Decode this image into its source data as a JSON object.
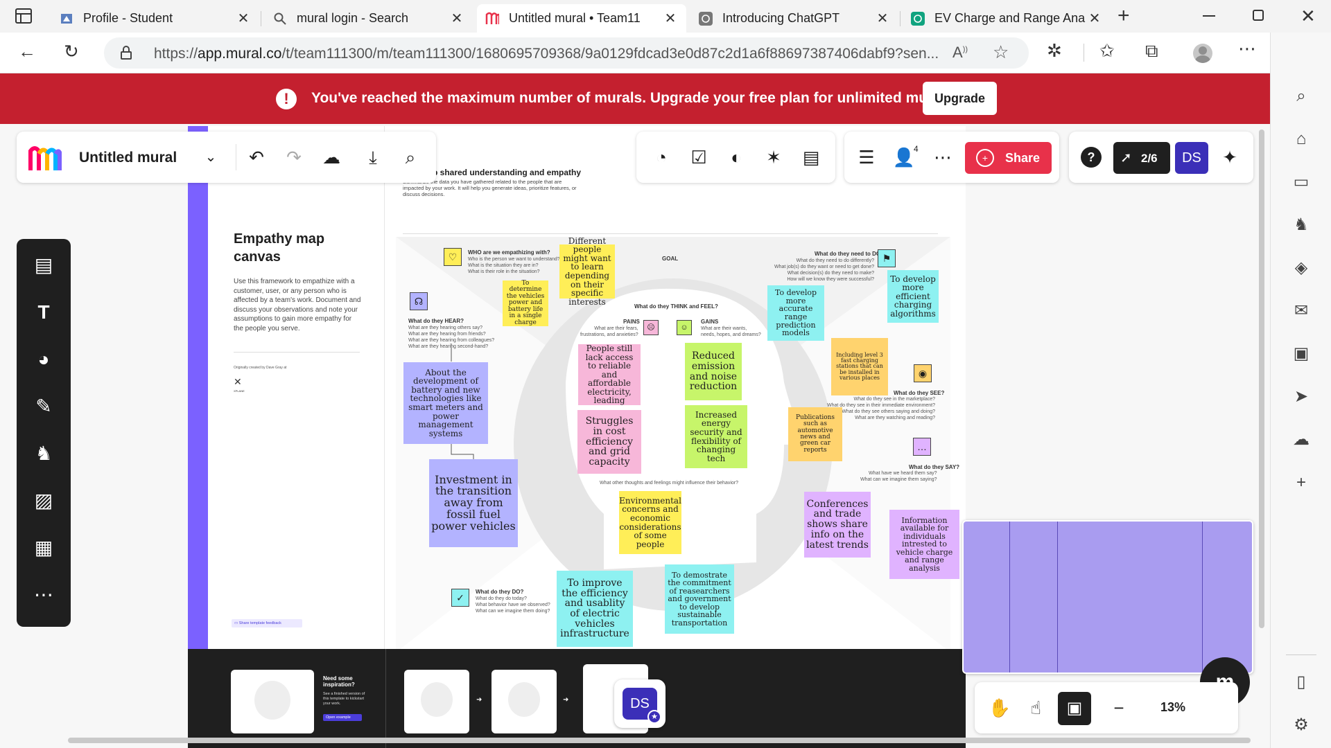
{
  "tabs": [
    {
      "title": "Profile - Student",
      "icon": "profile-page-icon",
      "active": false
    },
    {
      "title": "mural login - Search",
      "icon": "search-icon",
      "active": false
    },
    {
      "title": "Untitled mural • Team11",
      "icon": "mural-logo-icon",
      "active": true
    },
    {
      "title": "Introducing ChatGPT",
      "icon": "openai-icon",
      "active": false
    },
    {
      "title": "EV Charge and Range Ana",
      "icon": "openai-icon",
      "active": false
    }
  ],
  "address": {
    "prefix": "https://",
    "host": "app.mural.co",
    "path": "/t/team111300/m/team111300/1680695709368/9a0129fdcad3e0d87c2d1a6f88697387406dabf9?sen..."
  },
  "banner": {
    "message": "You've reached the maximum number of murals. Upgrade your free plan for unlimited murals.",
    "upgrade_label": "Upgrade",
    "color": "#c4202f"
  },
  "mural_toolbar": {
    "title": "Untitled mural",
    "share_label": "Share",
    "collaborator_count": "4",
    "progress": "2/6",
    "user_initials": "DS",
    "zoom": "13%"
  },
  "template": {
    "title_line1": "Empathy map",
    "title_line2": "canvas",
    "description": "Use this framework to empathize with a customer, user, or any person who is affected by a team's work. Document and discuss your observations and note your assumptions to gain more empathy for the people you serve.",
    "credit": "Originally created by Dave Gray at",
    "credit_logo": "XPLANE",
    "feedback": "Share template feedback",
    "header_title": "p shared understanding and empathy",
    "header_sub": "Summarize the data you have gathered related to the people that are impacted by your work. It will help you generate ideas, prioritize features, or discuss decisions.",
    "who_title": "WHO are we empathizing with?",
    "who_sub": "Who is the person we want to understand?\nWhat is the situation they are in?\nWhat is their role in the situation?",
    "goal": "GOAL",
    "need_title": "What do they need to DO?",
    "need_sub": "What do they need to do differently?\nWhat job(s) do they want or need to get done?\nWhat decision(s) do they need to make?\nHow will we know they were successful?",
    "hear_title": "What do they HEAR?",
    "hear_sub": "What are they hearing others say?\nWhat are they hearing from friends?\nWhat are they hearing from colleagues?\nWhat are they hearing second-hand?",
    "think_title": "What do they THINK and FEEL?",
    "pains_title": "PAINS",
    "pains_sub": "What are their fears,\nfrustrations, and anxieties?",
    "gains_title": "GAINS",
    "gains_sub": "What are their wants,\nneeds, hopes, and dreams?",
    "think_sub": "What other thoughts and feelings might influence their behavior?",
    "see_title": "What do they SEE?",
    "see_sub": "What do they see in the marketplace?\nWhat do they see in their immediate environment?\nWhat do they see others saying and doing?\nWhat are they watching and reading?",
    "say_title": "What do they SAY?",
    "say_sub": "What have we heard them say?\nWhat can we imagine them saying?",
    "do_title": "What do they DO?",
    "do_sub": "What do they do today?\nWhat behavior have we observed?\nWhat can we imagine them doing?",
    "inspiration_title": "Need some inspiration?",
    "inspiration_sub": "See a finished version of this template to kickstart your work.",
    "inspiration_btn": "Open example"
  },
  "stickies": [
    {
      "text": "Different people might want to learn depending on their specific interests",
      "color": "yellow"
    },
    {
      "text": "To determine the vehicles power and battery life in a single charge",
      "color": "yellow"
    },
    {
      "text": "To develop more accurate range prediction models",
      "color": "cyan"
    },
    {
      "text": "To develop more efficient charging algorithms",
      "color": "cyan"
    },
    {
      "text": "About the development of battery and new technologies like smart meters and power management systems",
      "color": "blue"
    },
    {
      "text": "Investment in the transition away from fossil fuel power vehicles",
      "color": "blue"
    },
    {
      "text": "People still lack access to reliable and affordable electricity, leading",
      "color": "pink"
    },
    {
      "text": "Struggles in cost efficiency and grid capacity",
      "color": "pink"
    },
    {
      "text": "Reduced emission and noise reduction",
      "color": "green"
    },
    {
      "text": "Increased energy security and flexibility of changing tech",
      "color": "green"
    },
    {
      "text": "Including level 3 fast charging stations that can be installed in various places",
      "color": "orange"
    },
    {
      "text": "Publications such as automotive news and green car reports",
      "color": "orange"
    },
    {
      "text": "Environmental concerns and economic considerations of some people",
      "color": "yellow"
    },
    {
      "text": "Conferences and trade shows share info on the latest trends",
      "color": "lavender"
    },
    {
      "text": "Information available for individuals intrested to vehicle charge and range analysis",
      "color": "lavender"
    },
    {
      "text": "To improve the efficiency and usablity of electric vehicles infrastructure",
      "color": "cyan"
    },
    {
      "text": "To demostrate the commitment of reasearchers and government to develop sustainable transportation",
      "color": "cyan"
    }
  ]
}
